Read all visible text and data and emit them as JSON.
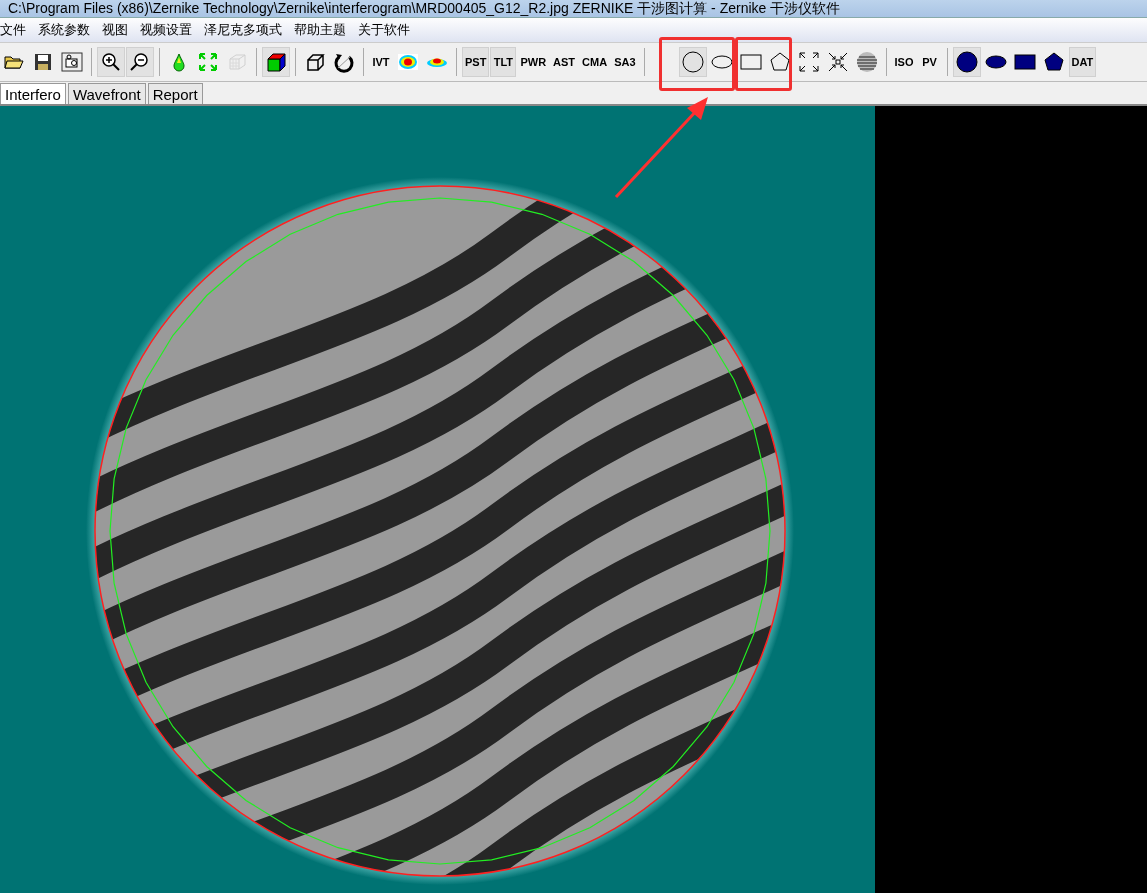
{
  "window": {
    "title": "C:\\Program Files (x86)\\Zernike Technology\\Zernike\\interferogram\\MRD00405_G12_R2.jpg ZERNIKE 干涉图计算 - Zernike 干涉仪软件"
  },
  "menu": [
    "文件",
    "系统参数",
    "视图",
    "视频设置",
    "泽尼克多项式",
    "帮助主题",
    "关于软件"
  ],
  "toolbar": [
    [
      {
        "kind": "icon",
        "pressed": false
      },
      {
        "kind": "icon",
        "pressed": false
      },
      {
        "kind": "icon",
        "pressed": false
      }
    ],
    [
      {
        "kind": "icon",
        "pressed": true
      },
      {
        "kind": "icon",
        "pressed": true
      }
    ],
    [
      {
        "kind": "icon",
        "pressed": false
      },
      {
        "kind": "icon",
        "pressed": false
      },
      {
        "kind": "icon",
        "pressed": false,
        "disabled": true
      }
    ],
    [
      {
        "kind": "icon",
        "pressed": true
      }
    ],
    [
      {
        "kind": "icon",
        "pressed": false
      },
      {
        "kind": "icon",
        "pressed": false
      }
    ],
    [
      {
        "kind": "text",
        "label": "IVT",
        "pressed": false
      },
      {
        "kind": "icon",
        "pressed": false
      },
      {
        "kind": "icon",
        "pressed": false
      }
    ],
    [
      {
        "kind": "text",
        "label": "PST",
        "pressed": true
      },
      {
        "kind": "text",
        "label": "TLT",
        "pressed": true
      },
      {
        "kind": "text",
        "label": "PWR",
        "pressed": false
      },
      {
        "kind": "text",
        "label": "AST",
        "pressed": false
      },
      {
        "kind": "text",
        "label": "CMA",
        "pressed": false
      },
      {
        "kind": "text",
        "label": "SA3",
        "pressed": false
      }
    ],
    [
      {
        "kind": "spacer"
      },
      {
        "kind": "icon",
        "pressed": true
      },
      {
        "kind": "icon",
        "pressed": false
      },
      {
        "kind": "icon",
        "pressed": false
      },
      {
        "kind": "icon",
        "pressed": false
      },
      {
        "kind": "icon",
        "pressed": false
      },
      {
        "kind": "icon",
        "pressed": false
      },
      {
        "kind": "icon",
        "pressed": false
      }
    ],
    [
      {
        "kind": "text",
        "label": "ISO",
        "pressed": false
      },
      {
        "kind": "text",
        "label": "PV",
        "pressed": false
      }
    ],
    [
      {
        "kind": "icon",
        "pressed": true
      },
      {
        "kind": "icon",
        "pressed": false
      },
      {
        "kind": "icon",
        "pressed": false
      },
      {
        "kind": "icon",
        "pressed": false
      },
      {
        "kind": "text",
        "label": "DAT",
        "pressed": true
      }
    ]
  ],
  "tabs": [
    {
      "label": "Interfero",
      "selected": true
    },
    {
      "label": "Wavefront",
      "selected": false
    },
    {
      "label": "Report",
      "selected": false
    }
  ]
}
